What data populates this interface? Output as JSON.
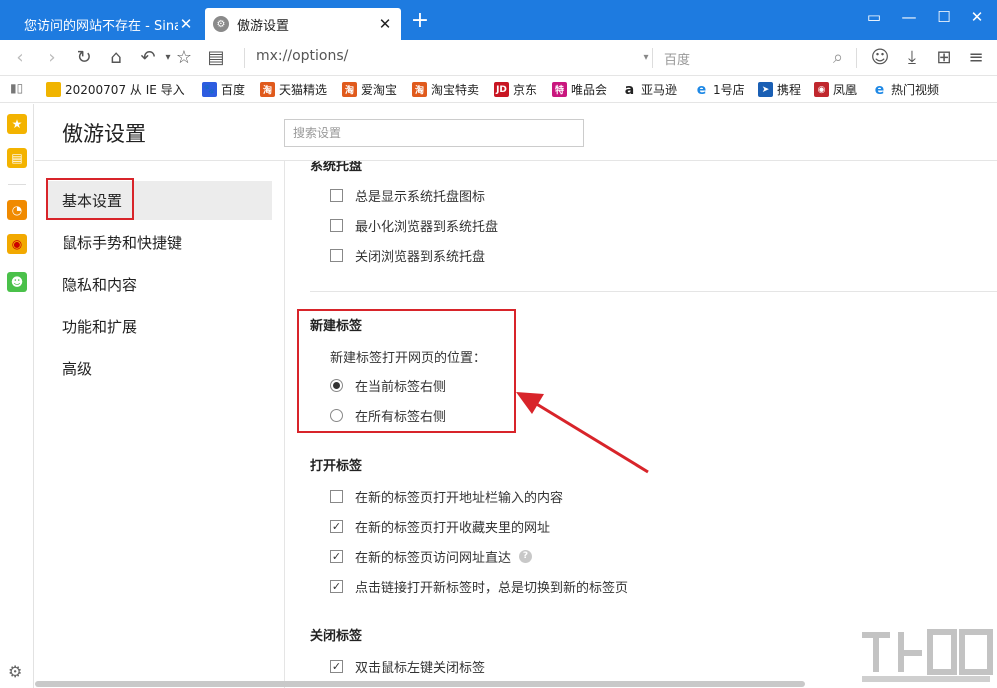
{
  "tabs": [
    {
      "title": "您访问的网站不存在 - Sina A",
      "active": false
    },
    {
      "title": "傲游设置",
      "active": true
    }
  ],
  "icons": {
    "new_tab": "plus-icon",
    "window": [
      "sidebar-toggle-icon",
      "minimize-icon",
      "maximize-icon",
      "close-icon"
    ]
  },
  "nav": {
    "address": "mx://options/",
    "search_placeholder": "百度"
  },
  "bookmarks": [
    {
      "label": "20200707 从 IE 导入",
      "color": "#f0b400",
      "glyph": ""
    },
    {
      "label": "百度",
      "color": "#2d5ce0",
      "glyph": "🐾"
    },
    {
      "label": "天猫精选",
      "color": "#e05a1c",
      "glyph": "淘"
    },
    {
      "label": "爱淘宝",
      "color": "#e05a1c",
      "glyph": "淘"
    },
    {
      "label": "淘宝特卖",
      "color": "#e05a1c",
      "glyph": "淘"
    },
    {
      "label": "京东",
      "color": "#c81623",
      "glyph": "JD"
    },
    {
      "label": "唯品会",
      "color": "#c9177e",
      "glyph": "特"
    },
    {
      "label": "亚马逊",
      "color": "#222222",
      "glyph": "a"
    },
    {
      "label": "1号店",
      "color": "#1e88e5",
      "glyph": "e"
    },
    {
      "label": "携程",
      "color": "#1a5fb4",
      "glyph": "➤"
    },
    {
      "label": "凤凰",
      "color": "#c0272d",
      "glyph": "◉"
    },
    {
      "label": "热门视频",
      "color": "#1e88e5",
      "glyph": "e"
    }
  ],
  "page": {
    "title": "傲游设置",
    "search_placeholder": "搜索设置"
  },
  "sidebar": {
    "items": [
      {
        "label": "基本设置",
        "active": true
      },
      {
        "label": "鼠标手势和快捷键",
        "active": false
      },
      {
        "label": "隐私和内容",
        "active": false
      },
      {
        "label": "功能和扩展",
        "active": false
      },
      {
        "label": "高级",
        "active": false
      }
    ]
  },
  "sections": {
    "tray": {
      "title": "系统托盘",
      "options": [
        {
          "label": "总是显示系统托盘图标",
          "checked": false
        },
        {
          "label": "最小化浏览器到系统托盘",
          "checked": false
        },
        {
          "label": "关闭浏览器到系统托盘",
          "checked": false
        }
      ]
    },
    "new_tab": {
      "title": "新建标签",
      "sub_label": "新建标签打开网页的位置：",
      "options": [
        {
          "label": "在当前标签右侧",
          "selected": true
        },
        {
          "label": "在所有标签右侧",
          "selected": false
        }
      ]
    },
    "open_tab": {
      "title": "打开标签",
      "options": [
        {
          "label": "在新的标签页打开地址栏输入的内容",
          "checked": false
        },
        {
          "label": "在新的标签页打开收藏夹里的网址",
          "checked": true
        },
        {
          "label": "在新的标签页访问网址直达",
          "checked": true
        },
        {
          "label": "点击链接打开新标签时，总是切换到新的标签页",
          "checked": true
        }
      ]
    },
    "close_tab": {
      "title": "关闭标签",
      "options": [
        {
          "label": "双击鼠标左键关闭标签",
          "checked": true
        }
      ]
    }
  },
  "colors": {
    "tabbar": "#1e7be0",
    "annotation": "#d8242a"
  }
}
